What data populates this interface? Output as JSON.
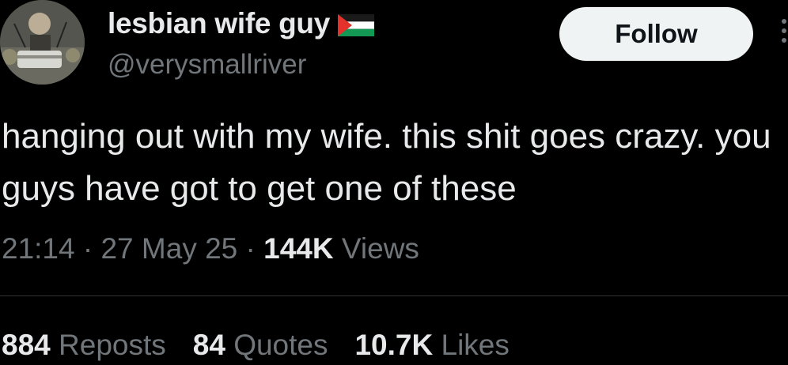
{
  "author": {
    "display_name": "lesbian wife guy",
    "handle": "@verysmallriver",
    "flag_icon": "palestine-flag-icon",
    "avatar_icon": "avatar-photo"
  },
  "follow_button": {
    "label": "Follow"
  },
  "tweet": {
    "text": "hanging out with my wife. this shit goes crazy. you guys have got to get one of these"
  },
  "meta": {
    "time": "21:14",
    "date": "27 May 25",
    "views_count": "144K",
    "views_label": "Views",
    "separator": " · "
  },
  "stats": [
    {
      "count": "884",
      "label": "Reposts"
    },
    {
      "count": "84",
      "label": "Quotes"
    },
    {
      "count": "10.7K",
      "label": "Likes"
    }
  ],
  "colors": {
    "background": "#000000",
    "text_primary": "#e7e9ea",
    "text_secondary": "#71767b",
    "button_bg": "#eff3f4",
    "divider": "#2f3336"
  }
}
